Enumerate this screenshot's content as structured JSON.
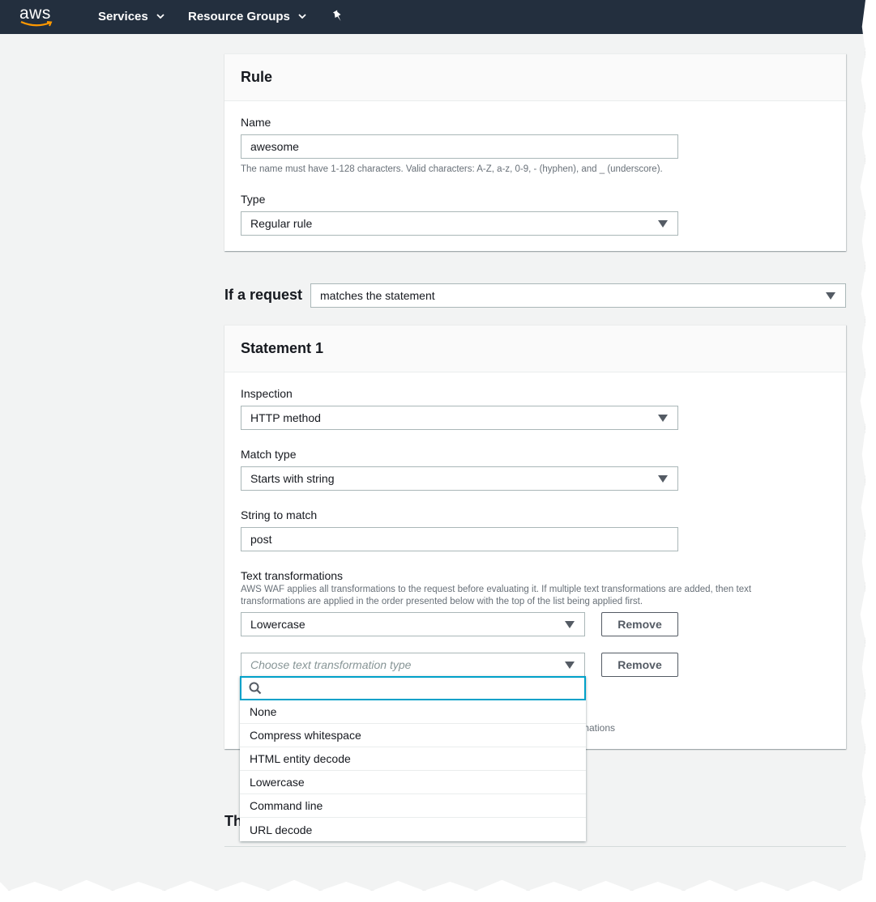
{
  "nav": {
    "logo": "aws",
    "services": "Services",
    "resource_groups": "Resource Groups"
  },
  "rule_panel": {
    "title": "Rule",
    "name_label": "Name",
    "name_value": "awesome",
    "name_hint": "The name must have 1-128 characters. Valid characters: A-Z, a-z, 0-9, - (hyphen), and _ (underscore).",
    "type_label": "Type",
    "type_value": "Regular rule"
  },
  "if_request": {
    "label": "If a request",
    "value": "matches the statement"
  },
  "statement_panel": {
    "title": "Statement 1",
    "inspection_label": "Inspection",
    "inspection_value": "HTTP method",
    "match_type_label": "Match type",
    "match_type_value": "Starts with string",
    "string_label": "String to match",
    "string_value": "post",
    "text_transform_label": "Text transformations",
    "text_transform_hint": "AWS WAF applies all transformations to the request before evaluating it. If multiple text transformations are added, then text transformations are applied in the order presented below with the top of the list being applied first.",
    "transform_1_value": "Lowercase",
    "transform_2_placeholder": "Choose text transformation type",
    "remove_label": "Remove",
    "partial_hidden_text": "mations"
  },
  "dropdown": {
    "search_placeholder": "",
    "options": [
      "None",
      "Compress whitespace",
      "HTML entity decode",
      "Lowercase",
      "Command line",
      "URL decode"
    ]
  },
  "bottom": {
    "partial_heading": "Th"
  },
  "colors": {
    "nav_bg": "#232f3e",
    "page_bg": "#f2f3f3",
    "focus": "#00a1c9",
    "logo_smile": "#ff9900"
  }
}
